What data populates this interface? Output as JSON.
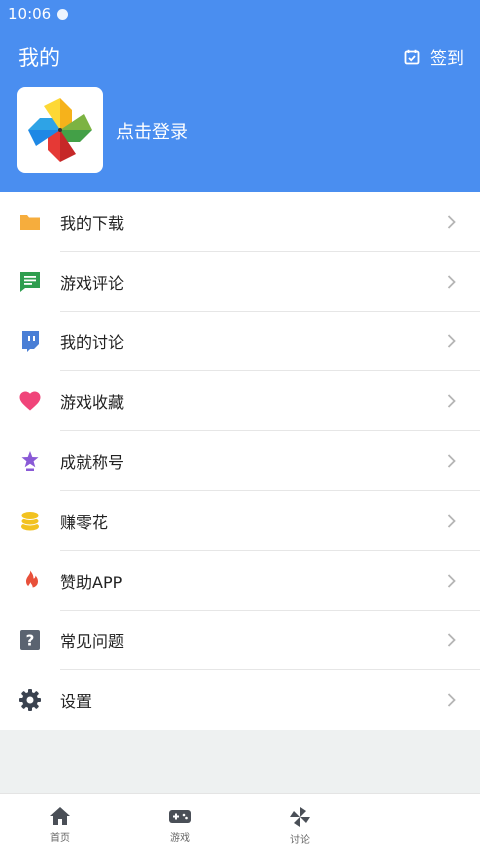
{
  "status": {
    "time": "10:06"
  },
  "header": {
    "title": "我的",
    "checkin_label": "签到",
    "login_label": "点击登录"
  },
  "menu": [
    {
      "label": "我的下载",
      "icon": "folder-icon",
      "color": "#f6ad3d"
    },
    {
      "label": "游戏评论",
      "icon": "comment-icon",
      "color": "#2e9e4f"
    },
    {
      "label": "我的讨论",
      "icon": "discussion-icon",
      "color": "#4a7fd6"
    },
    {
      "label": "游戏收藏",
      "icon": "heart-icon",
      "color": "#f0457a"
    },
    {
      "label": "成就称号",
      "icon": "achievement-icon",
      "color": "#8a5ad6"
    },
    {
      "label": "赚零花",
      "icon": "coins-icon",
      "color": "#f2c21f"
    },
    {
      "label": "赞助APP",
      "icon": "flame-icon",
      "color": "#e8503a"
    },
    {
      "label": "常见问题",
      "icon": "help-icon",
      "color": "#5a6370"
    },
    {
      "label": "设置",
      "icon": "gear-icon",
      "color": "#3b4350"
    }
  ],
  "tabs": [
    {
      "label": "首页",
      "icon": "home-icon"
    },
    {
      "label": "游戏",
      "icon": "gamepad-icon"
    },
    {
      "label": "讨论",
      "icon": "pinwheel-icon"
    }
  ],
  "colors": {
    "primary": "#4a8ef0",
    "background": "#eef1f1"
  }
}
